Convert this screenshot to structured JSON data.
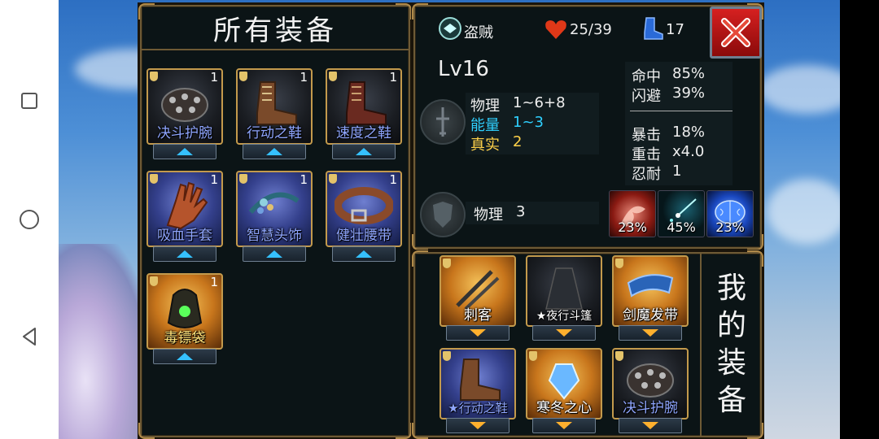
{
  "colors": {
    "panel_bg": "#0b1416",
    "border_gold": "#c39a4c",
    "energy_cyan": "#2fd0ff",
    "true_yellow": "#ffd24a",
    "close_red": "#d62020"
  },
  "all_equipment": {
    "title": "所有装备",
    "items": [
      {
        "label": "决斗护腕",
        "count": "1",
        "icon": "bracer-icon",
        "label_color": "blue"
      },
      {
        "label": "行动之鞋",
        "count": "1",
        "icon": "boots-icon",
        "label_color": "blue"
      },
      {
        "label": "速度之鞋",
        "count": "1",
        "icon": "boots-icon",
        "label_color": "blue"
      },
      {
        "label": "吸血手套",
        "count": "1",
        "icon": "glove-icon",
        "label_color": "blue"
      },
      {
        "label": "智慧头饰",
        "count": "1",
        "icon": "headband-icon",
        "label_color": "blue"
      },
      {
        "label": "健壮腰带",
        "count": "1",
        "icon": "belt-icon",
        "label_color": "blue"
      },
      {
        "label": "毒镖袋",
        "count": "1",
        "icon": "dart-bag-icon",
        "label_color": "yellow"
      }
    ]
  },
  "hero": {
    "class_name": "盗贼",
    "class_icon": "rogue-class-icon",
    "hp": "25/39",
    "move": "17",
    "level": "Lv16"
  },
  "attack": {
    "physical_label": "物理",
    "physical_value": "1~6+8",
    "energy_label": "能量",
    "energy_value": "1~3",
    "true_label": "真实",
    "true_value": "2"
  },
  "defense": {
    "physical_label": "物理",
    "physical_value": "3"
  },
  "stats": {
    "hit_label": "命中",
    "hit_value": "85%",
    "dodge_label": "闪避",
    "dodge_value": "39%",
    "crit_label": "暴击",
    "crit_value": "18%",
    "crit_dmg_label": "重击",
    "crit_dmg_value": "x4.0",
    "endure_label": "忍耐",
    "endure_value": "1"
  },
  "buffs": [
    {
      "value": "23%",
      "icon": "bleed-icon"
    },
    {
      "value": "45%",
      "icon": "spark-icon"
    },
    {
      "value": "23%",
      "icon": "brain-icon"
    }
  ],
  "my_equipment": {
    "title_chars": [
      "我",
      "的",
      "装",
      "备"
    ],
    "items": [
      {
        "label": "刺客",
        "icon": "daggers-icon",
        "label_color": "white"
      },
      {
        "label": "★夜行斗篷",
        "icon": "cloak-icon",
        "label_color": "white"
      },
      {
        "label": "剑魔发带",
        "icon": "hairband-icon",
        "label_color": "white"
      },
      {
        "label": "★行动之鞋",
        "icon": "boots-icon",
        "label_color": "blue"
      },
      {
        "label": "寒冬之心",
        "icon": "frost-heart-icon",
        "label_color": "white"
      },
      {
        "label": "决斗护腕",
        "icon": "bracer-icon",
        "label_color": "blue"
      }
    ]
  }
}
